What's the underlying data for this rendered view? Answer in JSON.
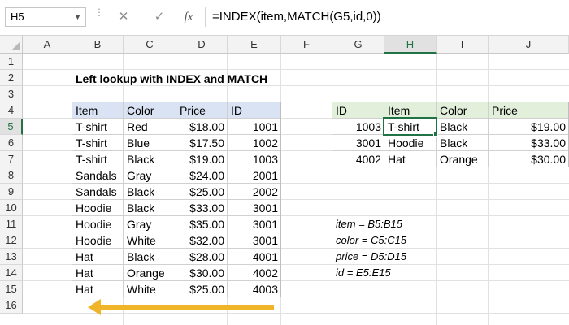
{
  "name_box": {
    "value": "H5"
  },
  "formula_bar": {
    "cancel_icon": "✕",
    "enter_icon": "✓",
    "fx_label": "fx",
    "formula": "=INDEX(item,MATCH(G5,id,0))"
  },
  "columns": [
    "A",
    "B",
    "C",
    "D",
    "E",
    "F",
    "G",
    "H",
    "I",
    "J"
  ],
  "rows": [
    "1",
    "2",
    "3",
    "4",
    "5",
    "6",
    "7",
    "8",
    "9",
    "10",
    "11",
    "12",
    "13",
    "14",
    "15",
    "16"
  ],
  "title": "Left lookup with INDEX and MATCH",
  "main_table": {
    "headers": [
      "Item",
      "Color",
      "Price",
      "ID"
    ],
    "rows": [
      [
        "T-shirt",
        "Red",
        "$18.00",
        "1001"
      ],
      [
        "T-shirt",
        "Blue",
        "$17.50",
        "1002"
      ],
      [
        "T-shirt",
        "Black",
        "$19.00",
        "1003"
      ],
      [
        "Sandals",
        "Gray",
        "$24.00",
        "2001"
      ],
      [
        "Sandals",
        "Black",
        "$25.00",
        "2002"
      ],
      [
        "Hoodie",
        "Black",
        "$33.00",
        "3001"
      ],
      [
        "Hoodie",
        "Gray",
        "$35.00",
        "3001"
      ],
      [
        "Hoodie",
        "White",
        "$32.00",
        "3001"
      ],
      [
        "Hat",
        "Black",
        "$28.00",
        "4001"
      ],
      [
        "Hat",
        "Orange",
        "$30.00",
        "4002"
      ],
      [
        "Hat",
        "White",
        "$25.00",
        "4003"
      ]
    ]
  },
  "lookup_table": {
    "headers": [
      "ID",
      "Item",
      "Color",
      "Price"
    ],
    "rows": [
      [
        "1003",
        "T-shirt",
        "Black",
        "$19.00"
      ],
      [
        "3001",
        "Hoodie",
        "Black",
        "$33.00"
      ],
      [
        "4002",
        "Hat",
        "Orange",
        "$30.00"
      ]
    ]
  },
  "named_ranges": [
    "item = B5:B15",
    "color = C5:C15",
    "price = D5:D15",
    "id = E5:E15"
  ],
  "colors": {
    "accent": "#217346",
    "main_header_bg": "#dae3f3",
    "lookup_header_bg": "#e2efda",
    "arrow": "#f0b429"
  },
  "arrow_direction": "left"
}
